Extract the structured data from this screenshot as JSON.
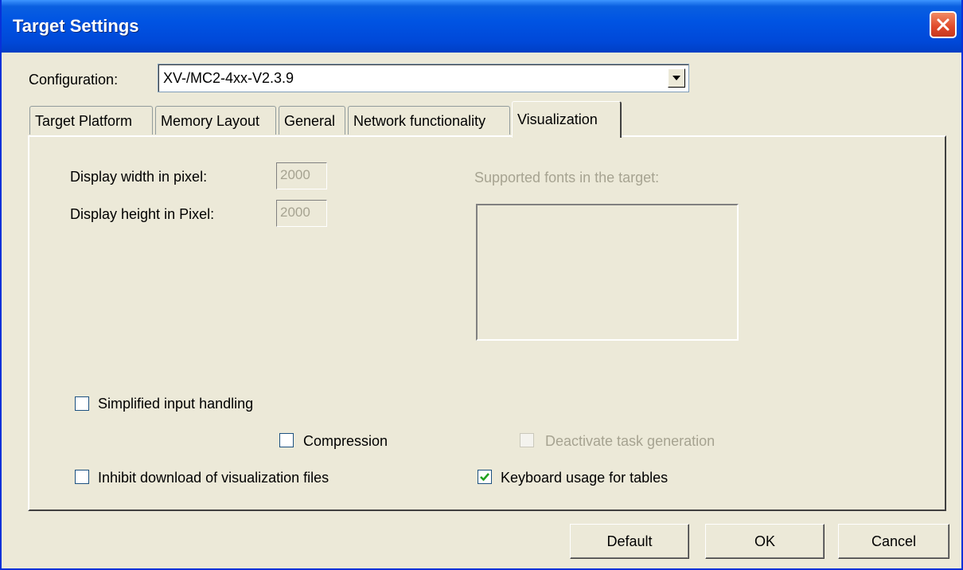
{
  "window": {
    "title": "Target Settings"
  },
  "configuration": {
    "label": "Configuration:",
    "value": "XV-/MC2-4xx-V2.3.9"
  },
  "tabs": [
    {
      "label": "Target Platform"
    },
    {
      "label": "Memory Layout"
    },
    {
      "label": "General"
    },
    {
      "label": "Network functionality"
    },
    {
      "label": "Visualization"
    }
  ],
  "active_tab": "Visualization",
  "visualization": {
    "display_width_label": "Display width in pixel:",
    "display_width_value": "2000",
    "display_height_label": "Display height in Pixel:",
    "display_height_value": "2000",
    "fonts_label": "Supported fonts in the target:",
    "simplified_input": {
      "label": "Simplified input handling",
      "checked": false
    },
    "compression": {
      "label": "Compression",
      "checked": false
    },
    "deactivate_task": {
      "label": "Deactivate task generation",
      "checked": false,
      "enabled": false
    },
    "inhibit_download": {
      "label": "Inhibit download of visualization files",
      "checked": false
    },
    "keyboard_tables": {
      "label": "Keyboard usage for tables",
      "checked": true
    }
  },
  "buttons": {
    "default": "Default",
    "ok": "OK",
    "cancel": "Cancel"
  },
  "icons": {
    "close": "close-icon",
    "dropdown": "chevron-down-icon",
    "checkmark": "checkmark-icon"
  },
  "colors": {
    "titlebar": "#0054e3",
    "face": "#ece9d8",
    "close": "#e0492a",
    "disabled_text": "#a6a391"
  }
}
